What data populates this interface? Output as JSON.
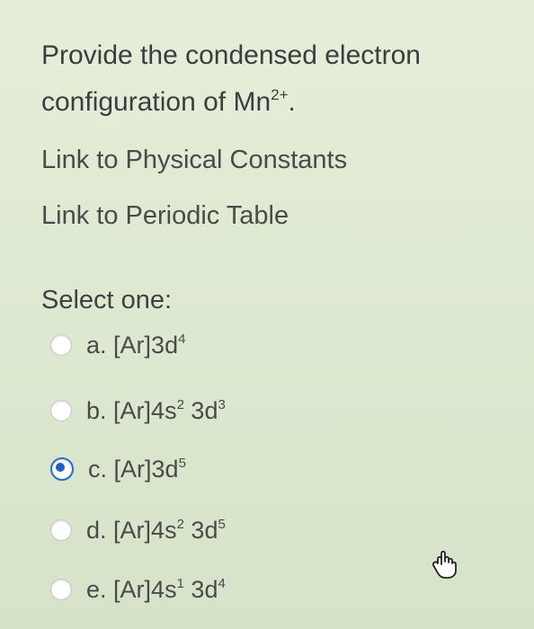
{
  "question": {
    "line1": "Provide the condensed electron",
    "line2_prefix": "configuration of Mn",
    "line2_sup": "2+",
    "line2_suffix": "."
  },
  "links": {
    "physical_constants": "Link to Physical Constants",
    "periodic_table": "Link to Periodic Table"
  },
  "select_label": "Select one:",
  "options": [
    {
      "letter": "a.",
      "parts": [
        "[Ar]3d",
        "4"
      ],
      "checked": false
    },
    {
      "letter": "b.",
      "parts": [
        "[Ar]4s",
        "2",
        " 3d",
        "3"
      ],
      "checked": false
    },
    {
      "letter": "c.",
      "parts": [
        "[Ar]3d",
        "5"
      ],
      "checked": true
    },
    {
      "letter": "d.",
      "parts": [
        "[Ar]4s",
        "2",
        " 3d",
        "5"
      ],
      "checked": false
    },
    {
      "letter": "e.",
      "parts": [
        "[Ar]4s",
        "1",
        " 3d",
        "4"
      ],
      "checked": false
    }
  ],
  "icons": {
    "cursor": "hand-pointer-icon"
  },
  "colors": {
    "background": "#dfe9d2",
    "radio_selected": "#1f5fc4"
  }
}
